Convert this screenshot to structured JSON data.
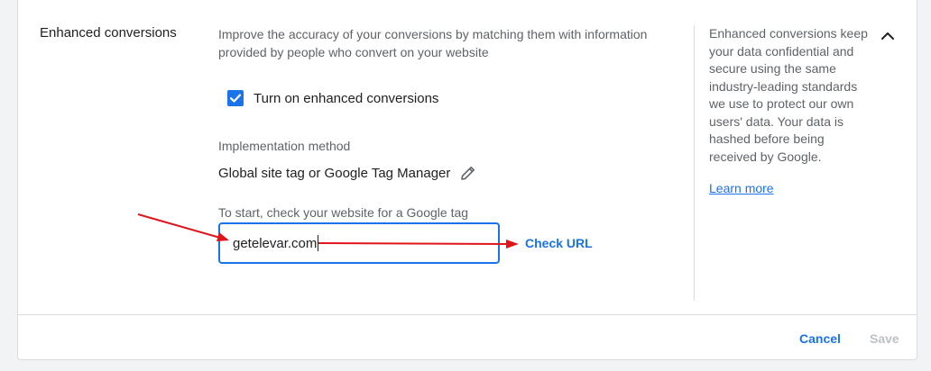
{
  "section": {
    "title": "Enhanced conversions",
    "description": "Improve the accuracy of your conversions by matching them with information provided by people who convert on your website"
  },
  "checkbox": {
    "label": "Turn on enhanced conversions",
    "checked": true
  },
  "implementation": {
    "label": "Implementation method",
    "value": "Global site tag or Google Tag Manager",
    "edit_icon": "pencil-icon"
  },
  "url_check": {
    "label": "To start, check your website for a Google tag",
    "value": "getelevar.com",
    "button_label": "Check URL"
  },
  "info": {
    "text": "Enhanced conversions keep your data confidential and secure using the same industry-leading standards we use to protect our own users' data. Your data is hashed before being received by Google.",
    "learn_more": "Learn more",
    "collapse_icon": "chevron-up-icon"
  },
  "footer": {
    "cancel_label": "Cancel",
    "save_label": "Save"
  },
  "colors": {
    "accent": "#1a73e8",
    "annotation_arrow": "#e0151b",
    "disabled": "#bdc1c6"
  }
}
